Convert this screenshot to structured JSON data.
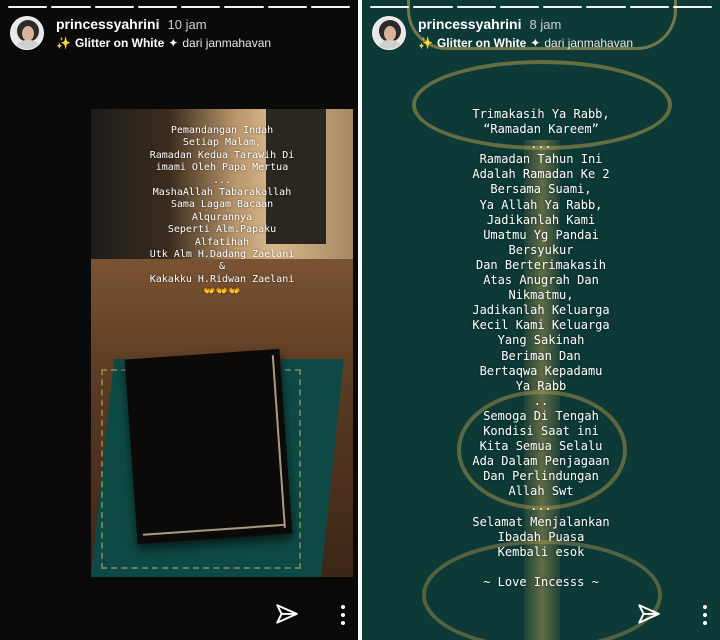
{
  "stories": [
    {
      "username": "princessyahrini",
      "time": "10 jam",
      "effect": {
        "name": "Glitter on White",
        "source": "dari janmahavan"
      },
      "caption": [
        "Pemandangan Indah",
        "Setiap Malam,",
        "Ramadan Kedua Tarawih Di",
        "imami Oleh Papa Mertua",
        "...",
        "MashaAllah Tabarakallah",
        "Sama Lagam Bacaan",
        "Alqurannya",
        "Seperti Alm.Papaku",
        "Alfatihah",
        "Utk Alm H.Dadang Zaelani",
        "&",
        "Kakakku H.Ridwan Zaelani",
        "👐👐👐"
      ]
    },
    {
      "username": "princessyahrini",
      "time": "8 jam",
      "effect": {
        "name": "Glitter on White",
        "source": "dari janmahavan"
      },
      "caption": [
        "Trimakasih Ya Rabb,",
        "“Ramadan Kareem”",
        "...",
        "Ramadan Tahun Ini",
        "Adalah Ramadan Ke 2",
        "Bersama Suami,",
        "Ya Allah Ya Rabb,",
        "Jadikanlah Kami",
        "Umatmu Yg Pandai",
        "Bersyukur",
        "Dan Berterimakasih",
        "Atas Anugrah Dan",
        "Nikmatmu,",
        "Jadikanlah Keluarga",
        "Kecil Kami Keluarga",
        "Yang Sakinah",
        "Beriman Dan",
        "Bertaqwa Kepadamu",
        "Ya Rabb",
        "..",
        "Semoga Di Tengah",
        "Kondisi Saat ini",
        "Kita Semua Selalu",
        "Ada Dalam Penjagaan",
        "Dan Perlindungan",
        "Allah Swt",
        "...",
        "Selamat Menjalankan",
        "Ibadah Puasa",
        "Kembali esok",
        "",
        "~ Love Incesss ~"
      ]
    }
  ],
  "icons": {
    "send": "paper-plane-icon",
    "more": "vertical-ellipsis-icon",
    "effect": "sparkle-icon"
  },
  "colors": {
    "left_background": "#0a0a0a",
    "right_background": "#0d3a36",
    "gold": "#c8aa5a"
  }
}
